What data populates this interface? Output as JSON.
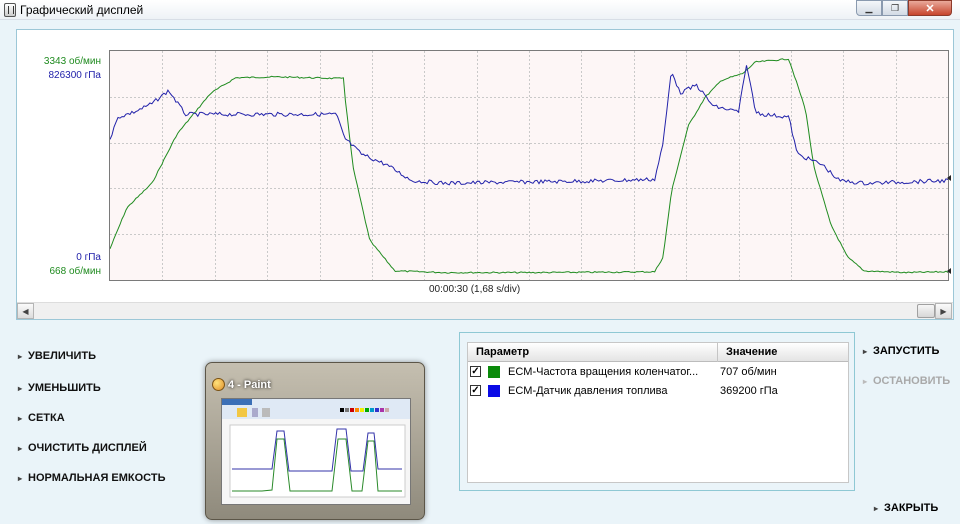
{
  "window": {
    "title": "Графический дисплей"
  },
  "chart": {
    "y_labels": {
      "green_top": "3343 об/мин",
      "blue_top": "826300 гПа",
      "blue_bottom": "0 гПа",
      "green_bottom": "668 об/мин"
    },
    "time_label": "00:00:30 (1,68 s/div)"
  },
  "chart_data": {
    "type": "line",
    "grid": true,
    "series": [
      {
        "name": "ECM-Частота вращения коленчатого вала",
        "color": "#1f8b1f",
        "ylim": [
          668,
          3343
        ],
        "points": [
          [
            0,
            1000
          ],
          [
            0.02,
            1500
          ],
          [
            0.05,
            1800
          ],
          [
            0.08,
            2400
          ],
          [
            0.12,
            2900
          ],
          [
            0.15,
            3090
          ],
          [
            0.2,
            3100
          ],
          [
            0.28,
            3100
          ],
          [
            0.275,
            3080
          ],
          [
            0.28,
            2900
          ],
          [
            0.29,
            2000
          ],
          [
            0.31,
            1100
          ],
          [
            0.34,
            730
          ],
          [
            0.4,
            710
          ],
          [
            0.5,
            710
          ],
          [
            0.6,
            715
          ],
          [
            0.65,
            720
          ],
          [
            0.66,
            900
          ],
          [
            0.67,
            1700
          ],
          [
            0.69,
            2500
          ],
          [
            0.71,
            2850
          ],
          [
            0.73,
            3060
          ],
          [
            0.755,
            3140
          ],
          [
            0.77,
            3280
          ],
          [
            0.81,
            3320
          ],
          [
            0.83,
            2700
          ],
          [
            0.84,
            2000
          ],
          [
            0.86,
            1300
          ],
          [
            0.88,
            900
          ],
          [
            0.9,
            730
          ],
          [
            0.95,
            710
          ],
          [
            1.0,
            720
          ]
        ]
      },
      {
        "name": "ECM-Датчик давления топлива",
        "color": "#2222aa",
        "ylim": [
          0,
          826300
        ],
        "points": [
          [
            0,
            520000
          ],
          [
            0.01,
            600000
          ],
          [
            0.03,
            620000
          ],
          [
            0.05,
            650000
          ],
          [
            0.07,
            700000
          ],
          [
            0.09,
            610000
          ],
          [
            0.12,
            610000
          ],
          [
            0.18,
            610000
          ],
          [
            0.27,
            610000
          ],
          [
            0.28,
            520000
          ],
          [
            0.3,
            460000
          ],
          [
            0.33,
            420000
          ],
          [
            0.36,
            360000
          ],
          [
            0.4,
            350000
          ],
          [
            0.5,
            355000
          ],
          [
            0.6,
            360000
          ],
          [
            0.65,
            365000
          ],
          [
            0.66,
            500000
          ],
          [
            0.67,
            780000
          ],
          [
            0.68,
            690000
          ],
          [
            0.7,
            720000
          ],
          [
            0.72,
            640000
          ],
          [
            0.75,
            620000
          ],
          [
            0.76,
            800000
          ],
          [
            0.77,
            620000
          ],
          [
            0.78,
            610000
          ],
          [
            0.81,
            600000
          ],
          [
            0.82,
            460000
          ],
          [
            0.85,
            420000
          ],
          [
            0.87,
            360000
          ],
          [
            0.9,
            350000
          ],
          [
            0.95,
            355000
          ],
          [
            1.0,
            360000
          ]
        ]
      }
    ]
  },
  "actions": [
    {
      "label": "УВЕЛИЧИТЬ",
      "name": "zoom-in-button"
    },
    {
      "label": "УМЕНЬШИТЬ",
      "name": "zoom-out-button"
    },
    {
      "label": "СЕТКА",
      "name": "grid-button"
    },
    {
      "label": "ОЧИСТИТЬ ДИСПЛЕЙ",
      "name": "clear-display-button"
    },
    {
      "label": "НОРМАЛЬНАЯ ЕМКОСТЬ",
      "name": "normal-capacity-button"
    }
  ],
  "taskbar_thumbnail": {
    "title": "4 - Paint"
  },
  "params": {
    "headers": {
      "param": "Параметр",
      "value": "Значение"
    },
    "rows": [
      {
        "name": "ECM-Частота вращения коленчатог...",
        "value": "707 об/мин",
        "color": "#0a8a0a",
        "checked": true
      },
      {
        "name": "ECM-Датчик давления топлива",
        "value": "369200 гПа",
        "color": "#0a0ae6",
        "checked": true
      }
    ]
  },
  "controls": {
    "start": "ЗАПУСТИТЬ",
    "stop": "ОСТАНОВИТЬ",
    "close": "ЗАКРЫТЬ"
  }
}
